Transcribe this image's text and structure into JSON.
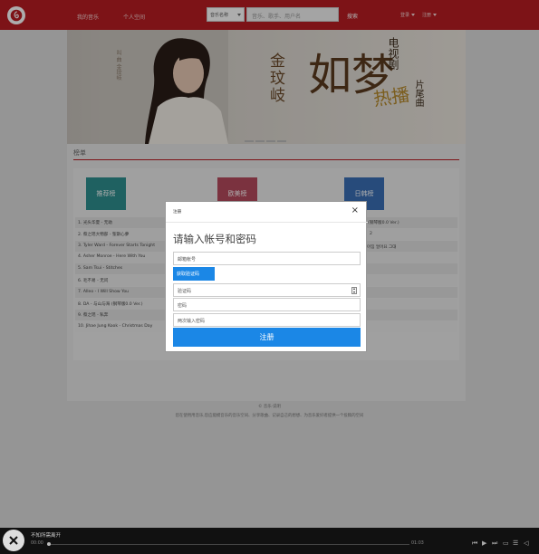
{
  "header": {
    "nav_my_music": "我的音乐",
    "nav_profile": "个人空间",
    "search_type": "音乐名称",
    "search_placeholder": "音乐、歌手、用户名",
    "search_button": "搜索",
    "login": "登录",
    "register": "注册"
  },
  "banner": {
    "left_text": "叫 曲 金玟岐",
    "artist": "金玟岐",
    "title": "如梦",
    "right_small": "电视剧",
    "right_tag": "热播",
    "right_sub": "片尾曲",
    "indicator_count": 4
  },
  "section": {
    "title": "榜单"
  },
  "charts": {
    "card1": "推荐榜",
    "card2": "欧美榜",
    "card3": "日韩榜",
    "colors": {
      "card1": "#2f8f8f",
      "card2": "#b54a5d",
      "card3": "#3a6fb5"
    }
  },
  "songs": [
    "1. 光头华夏 - 无助",
    "2. 蔡之瑶大物部 - 聖斯心夢",
    "3. Tyler Ward - Forever Starts Tonight",
    "4. Asher Monroe - Here With You",
    "5. Sam Tsui - Stitches",
    "6. 毛不易 - 无问",
    "7. Alleo - I Will Show You",
    "8. DA - 与山与海 (钢琴版0.0 Ver.)",
    "9. 蔡之瑶 - 私奔",
    "10. Jihae Jung Kook - Christmas Day"
  ],
  "right_list": {
    "item1": "蕾 (钢琴版0.0 Ver.)",
    "item2": "2",
    "item3": "아짐 얼어요 그대"
  },
  "modal": {
    "title": "注册",
    "close": "×",
    "heading": "请输入帐号和密码",
    "email_placeholder": "邮箱帐号",
    "get_code": "获取验证码",
    "code_placeholder": "验证码",
    "password_placeholder": "密码",
    "repeat_placeholder": "两次输入密码",
    "submit": "注册"
  },
  "footer": {
    "line1": "© 音乐·说明",
    "line2": "您在使用用音乐,您应能模音乐的音乐空间、分享歌曲、记录自己的想想、为音乐爱好者提供一个投稿的空间"
  },
  "player": {
    "title": "不知所需离开",
    "time_current": "00:00",
    "time_total": "01:03"
  }
}
